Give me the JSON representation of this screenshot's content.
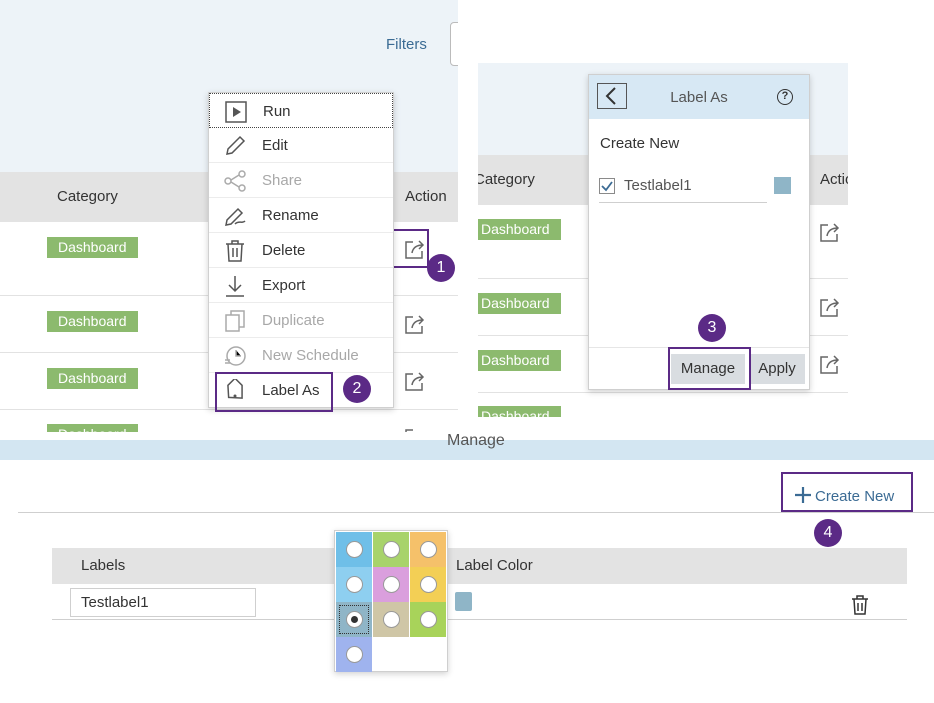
{
  "panel1": {
    "filters_label": "Filters",
    "columns": {
      "category": "Category",
      "action": "Action"
    },
    "rows": [
      {
        "category": "Dashboard"
      },
      {
        "category": "Dashboard"
      },
      {
        "category": "Dashboard"
      },
      {
        "category": "Dashboard"
      }
    ],
    "menu": [
      {
        "label": "Run",
        "icon": "run-icon",
        "disabled": false
      },
      {
        "label": "Edit",
        "icon": "pencil-icon",
        "disabled": false
      },
      {
        "label": "Share",
        "icon": "share-icon",
        "disabled": true
      },
      {
        "label": "Rename",
        "icon": "rename-icon",
        "disabled": false
      },
      {
        "label": "Delete",
        "icon": "trash-icon",
        "disabled": false
      },
      {
        "label": "Export",
        "icon": "export-icon",
        "disabled": false
      },
      {
        "label": "Duplicate",
        "icon": "duplicate-icon",
        "disabled": true
      },
      {
        "label": "New Schedule",
        "icon": "schedule-icon",
        "disabled": true
      },
      {
        "label": "Label As",
        "icon": "tag-icon",
        "disabled": false
      }
    ]
  },
  "panel2": {
    "columns": {
      "category": "Category",
      "action": "Actio"
    },
    "rows": [
      {
        "category": "Dashboard"
      },
      {
        "category": "Dashboard"
      },
      {
        "category": "Dashboard"
      },
      {
        "category": "Dashboard"
      }
    ],
    "popup": {
      "title": "Label As",
      "create_new": "Create New",
      "labels": [
        {
          "name": "Testlabel1",
          "checked": true,
          "color": "#8fb5c7"
        }
      ],
      "manage_button": "Manage",
      "apply_button": "Apply"
    }
  },
  "panel3": {
    "title": "Manage",
    "create_new_button": "Create New",
    "columns": {
      "labels": "Labels",
      "label_color": "Label Color"
    },
    "rows": [
      {
        "label": "Testlabel1",
        "color": "#8fb5c7"
      }
    ],
    "palette": [
      {
        "color": "#6fbfe8",
        "selected": false
      },
      {
        "color": "#a8d36b",
        "selected": false
      },
      {
        "color": "#f5c16a",
        "selected": false
      },
      {
        "color": "#8ecff0",
        "selected": false
      },
      {
        "color": "#da9fdd",
        "selected": false
      },
      {
        "color": "#f3cf55",
        "selected": false
      },
      {
        "color": "#8fb5c7",
        "selected": true
      },
      {
        "color": "#cfc6a6",
        "selected": false
      },
      {
        "color": "#a8d35a",
        "selected": false
      },
      {
        "color": "#9fb3ee",
        "selected": false
      }
    ]
  },
  "step_badges": [
    "1",
    "2",
    "3",
    "4"
  ],
  "colors": {
    "tag": "#8cba6e",
    "callout": "#5b2a86",
    "header_bg": "#e3e3e3",
    "band_bg": "#edf3f8"
  }
}
